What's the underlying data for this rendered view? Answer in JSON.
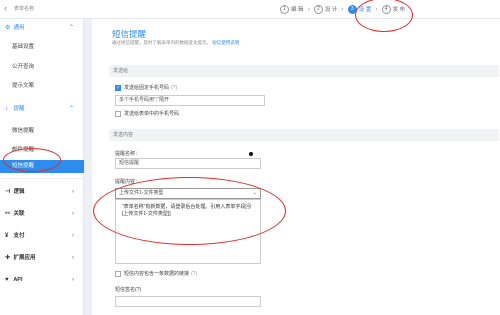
{
  "topbar": {
    "back_icon": "chevron-left-icon",
    "app_name": "表单名称",
    "steps": [
      {
        "num": "1",
        "label": "编 辑"
      },
      {
        "num": "2",
        "label": "设 计"
      },
      {
        "num": "3",
        "label": "设 置"
      },
      {
        "num": "4",
        "label": "发 布"
      }
    ]
  },
  "sidebar": {
    "general": "通用",
    "general_items": [
      "基础设置",
      "公开查询",
      "提示文案"
    ],
    "reminder": "提醒",
    "reminder_items": [
      "微信提醒",
      "邮件提醒",
      "短信提醒"
    ],
    "groups": [
      "逻辑",
      "关联",
      "支付",
      "扩展应用",
      "API"
    ]
  },
  "main": {
    "title": "短信提醒",
    "desc": "通过短信提醒，及时了解表单内的数据变化提示。",
    "desc_link": "短信使用说明",
    "send_to": "发送给",
    "check_fixed": "发送给固定手机号码",
    "check_fixed_hint": "(?)",
    "phone_placeholder": "多个手机号码用\";\"隔开",
    "check_form": "发送给表单中的手机号码",
    "content_section": "发送内容",
    "name_label": "提醒名称：",
    "name_value": "短信提醒",
    "content_label": "提醒内容：",
    "select_value": "上传文件1-文件类型",
    "message_text": "“表单名称”有新数据，请登录后台处理。引用入表单字段[引[上传文件1-文件类型]]",
    "check_link": "短信内容包含一条数据的链接",
    "check_link_hint": "(?)",
    "signature_label": "短信签名(?)"
  },
  "accent": "#2d8cf0",
  "annotation_color": "#e32b2b"
}
